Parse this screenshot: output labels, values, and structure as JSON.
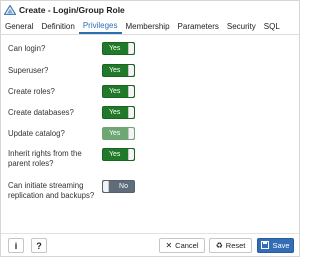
{
  "window": {
    "title": "Create - Login/Group Role"
  },
  "tabs": [
    {
      "label": "General"
    },
    {
      "label": "Definition"
    },
    {
      "label": "Privileges"
    },
    {
      "label": "Membership"
    },
    {
      "label": "Parameters"
    },
    {
      "label": "Security"
    },
    {
      "label": "SQL"
    }
  ],
  "active_tab": "Privileges",
  "privileges": [
    {
      "label": "Can login?",
      "value": "Yes"
    },
    {
      "label": "Superuser?",
      "value": "Yes"
    },
    {
      "label": "Create roles?",
      "value": "Yes"
    },
    {
      "label": "Create databases?",
      "value": "Yes"
    },
    {
      "label": "Update catalog?",
      "value": "Yes",
      "disabled": true
    },
    {
      "label": "Inherit rights from the parent roles?",
      "value": "Yes"
    },
    {
      "label": "Can initiate streaming replication and backups?",
      "value": "No"
    }
  ],
  "footer": {
    "info_label": "i",
    "help_label": "?",
    "cancel_label": "Cancel",
    "reset_label": "Reset",
    "save_label": "Save"
  },
  "colors": {
    "accent": "#2b6fb0",
    "toggle_on": "#217a2a",
    "toggle_off": "#5f6c7a",
    "primary_button": "#326db6"
  }
}
